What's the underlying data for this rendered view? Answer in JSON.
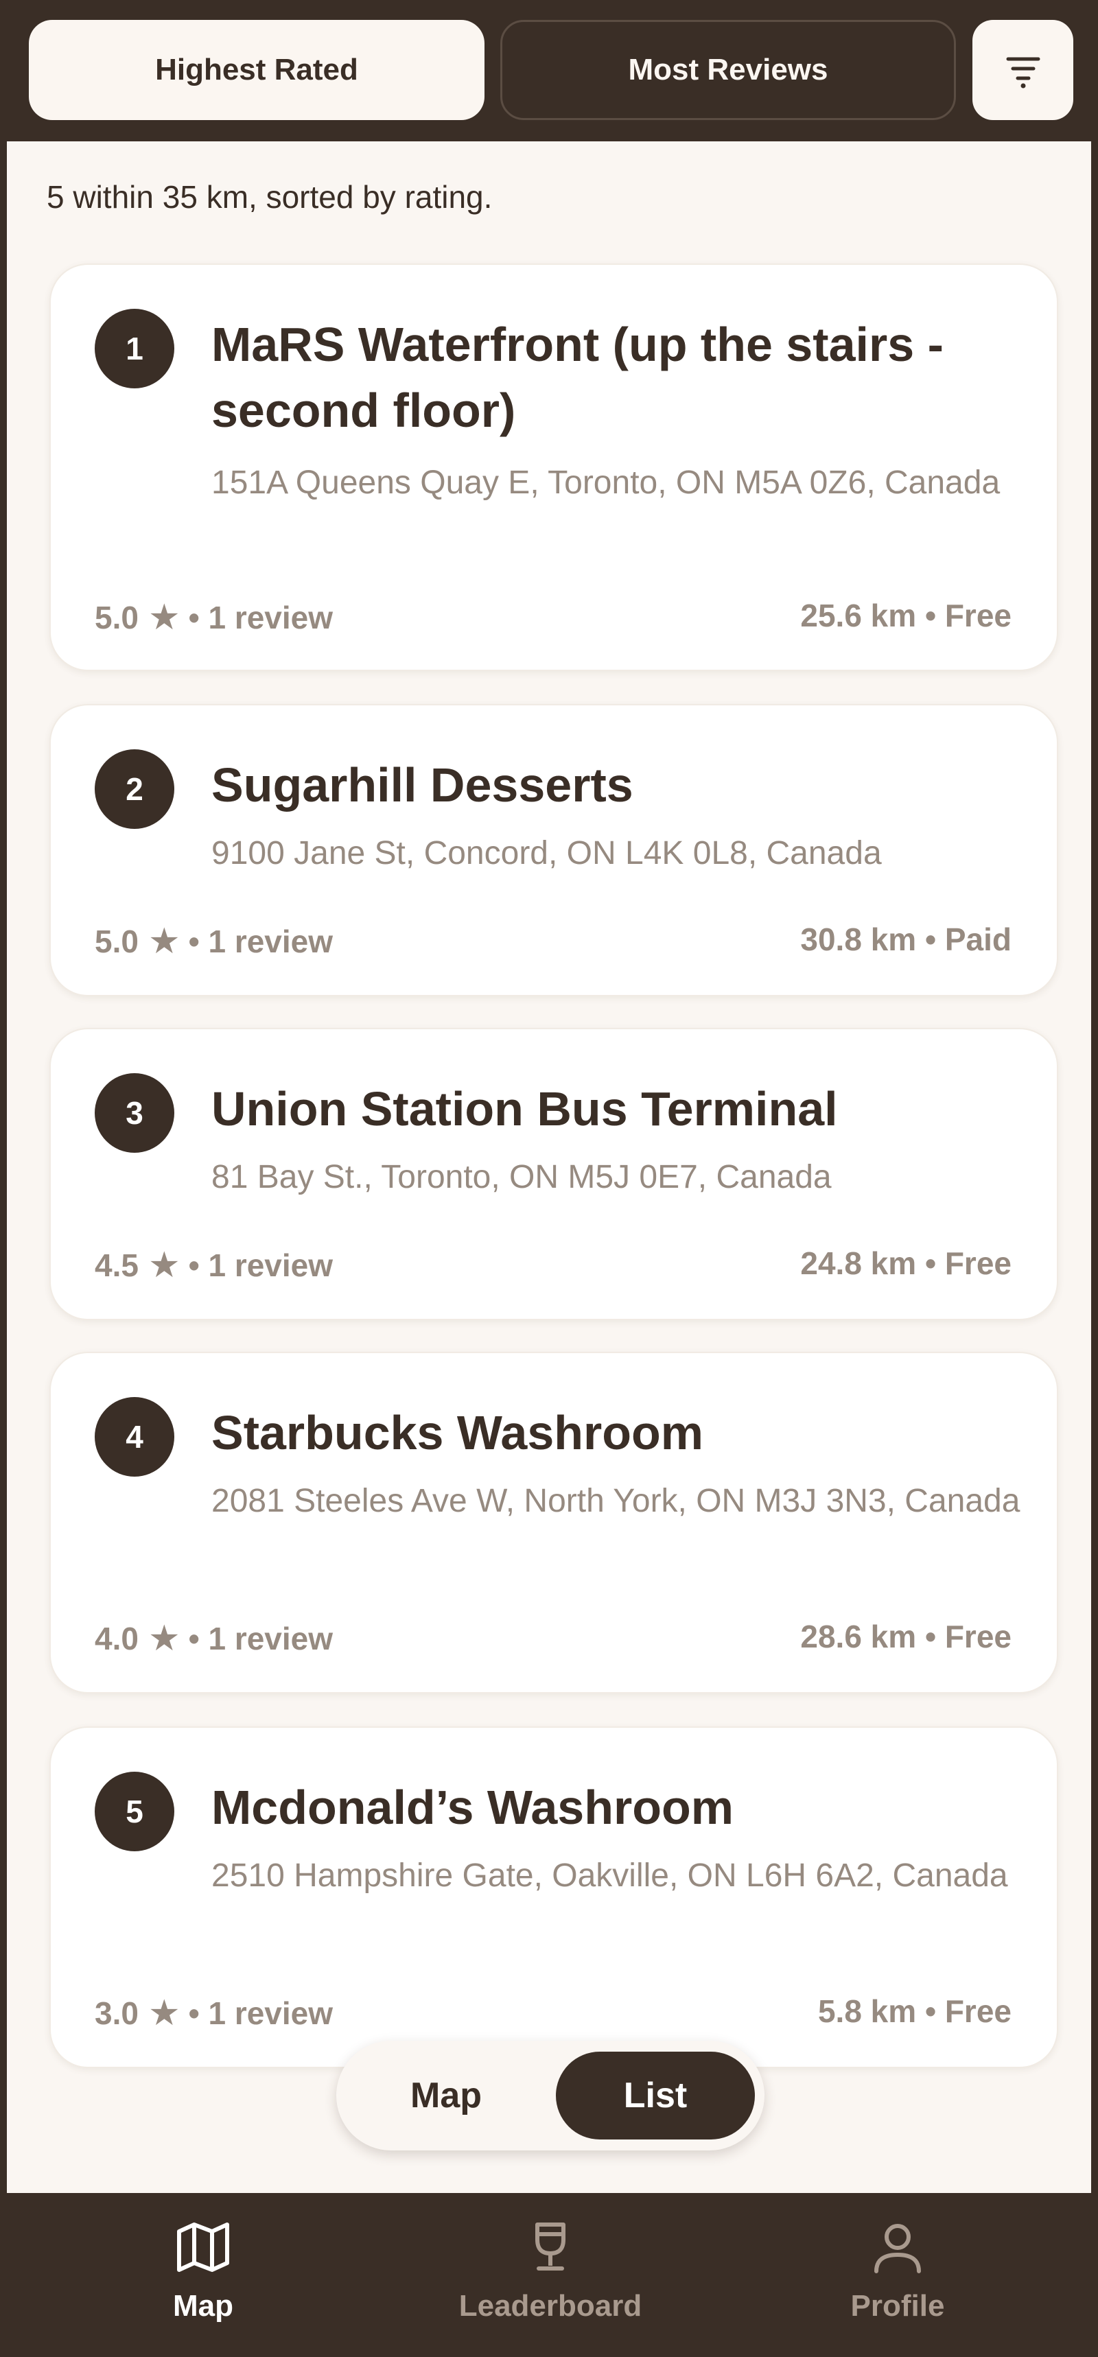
{
  "sort": {
    "highest_rated": "Highest Rated",
    "most_reviews": "Most Reviews",
    "filter_icon": "filter-icon"
  },
  "summary": "5 within 35 km, sorted by rating.",
  "results": [
    {
      "rank": "1",
      "name": "MaRS Waterfront (up the stairs - second floor)",
      "address": "151A Queens Quay E, Toronto, ON M5A 0Z6, Canada",
      "rating": "5.0",
      "reviews": "• 1 review",
      "meta": "25.6 km • Free"
    },
    {
      "rank": "2",
      "name": "Sugarhill Desserts",
      "address": "9100 Jane St, Concord, ON L4K 0L8, Canada",
      "rating": "5.0",
      "reviews": "• 1 review",
      "meta": "30.8 km • Paid"
    },
    {
      "rank": "3",
      "name": "Union Station Bus Terminal",
      "address": "81 Bay St., Toronto, ON M5J 0E7, Canada",
      "rating": "4.5",
      "reviews": "• 1 review",
      "meta": "24.8 km • Free"
    },
    {
      "rank": "4",
      "name": "Starbucks Washroom",
      "address": "2081 Steeles Ave W, North York, ON M3J 3N3, Canada",
      "rating": "4.0",
      "reviews": "• 1 review",
      "meta": "28.6 km • Free"
    },
    {
      "rank": "5",
      "name": "Mcdonald’s Washroom",
      "address": "2510 Hampshire Gate, Oakville, ON L6H 6A2, Canada",
      "rating": "3.0",
      "reviews": "• 1 review",
      "meta": "5.8 km • Free"
    }
  ],
  "view_toggle": {
    "map": "Map",
    "list": "List",
    "selected": "List"
  },
  "nav": {
    "map": "Map",
    "leaderboard": "Leaderboard",
    "profile": "Profile",
    "active": "Map"
  },
  "colors": {
    "primary": "#3a2e26",
    "background": "#faf6f2",
    "muted_text": "#968a80",
    "card": "#ffffff"
  }
}
